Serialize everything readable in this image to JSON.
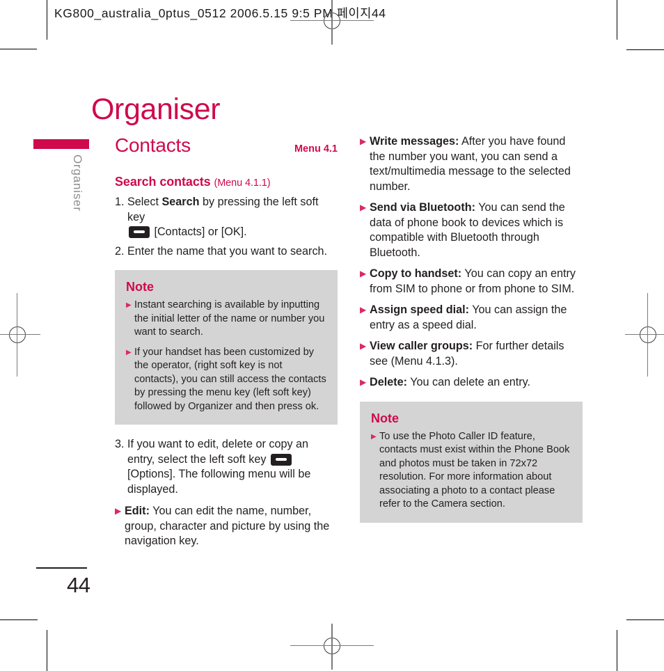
{
  "prepress": {
    "header_line": "KG800_australia_0ptus_0512  2006.5.15 9:5  PM 페이지44"
  },
  "page": {
    "title": "Organiser",
    "side_tab_label": "Organiser",
    "page_number": "44"
  },
  "section": {
    "title": "Contacts",
    "menu_ref": "Menu 4.1"
  },
  "left_column": {
    "sub_head": "Search contacts",
    "sub_head_menu_ref": "(Menu 4.1.1)",
    "steps": [
      {
        "num": "1.",
        "text_before": "Select ",
        "bold": "Search",
        "text_mid": " by pressing the left soft key",
        "icon": "softkey-icon",
        "text_after": " [Contacts] or [OK]."
      },
      {
        "num": "2.",
        "text_before": "Enter the name that you want to search.",
        "bold": "",
        "text_mid": "",
        "icon": "",
        "text_after": ""
      }
    ],
    "note": {
      "title": "Note",
      "bullets": [
        "Instant searching is available by inputting the initial letter of the name or number you want to search.",
        "If your handset has been customized by the operator, (right soft key is not contacts), you can still access the contacts by pressing the menu key (left soft key) followed by Organizer and then press ok."
      ]
    },
    "step3": {
      "num": "3.",
      "text_before": "If you want to edit, delete or copy an entry, select the left soft key ",
      "icon": "softkey-icon",
      "text_after": " [Options]. The following menu will be displayed."
    },
    "options": [
      {
        "label": "Edit:",
        "text": " You can edit the name, number, group, character and picture by using the navigation key."
      }
    ]
  },
  "right_column": {
    "options": [
      {
        "label": "Write messages:",
        "text": " After you have found the number you want, you can send a text/multimedia message to the selected number."
      },
      {
        "label": "Send via Bluetooth:",
        "text": " You can send the data of phone book to devices which is compatible with Bluetooth through Bluetooth."
      },
      {
        "label": "Copy to handset:",
        "text": " You can copy an entry from SIM to phone or from phone to SIM."
      },
      {
        "label": "Assign speed dial:",
        "text": " You can assign the entry as a speed dial."
      },
      {
        "label": "View caller groups:",
        "text": " For further details see (Menu 4.1.3)."
      },
      {
        "label": "Delete:",
        "text": " You can delete an entry."
      }
    ],
    "note": {
      "title": "Note",
      "bullets": [
        "To use the Photo Caller ID feature, contacts must exist within the Phone Book and photos must be taken in 72x72 resolution. For more information about associating a photo to a contact please refer to the Camera section."
      ]
    }
  },
  "colors": {
    "brand_crimson": "#cf0a4b",
    "bullet_pink": "#d92b63",
    "note_background": "#d4d4d4",
    "body_text": "#231f20",
    "side_tab_gray": "#8d8d8d"
  }
}
